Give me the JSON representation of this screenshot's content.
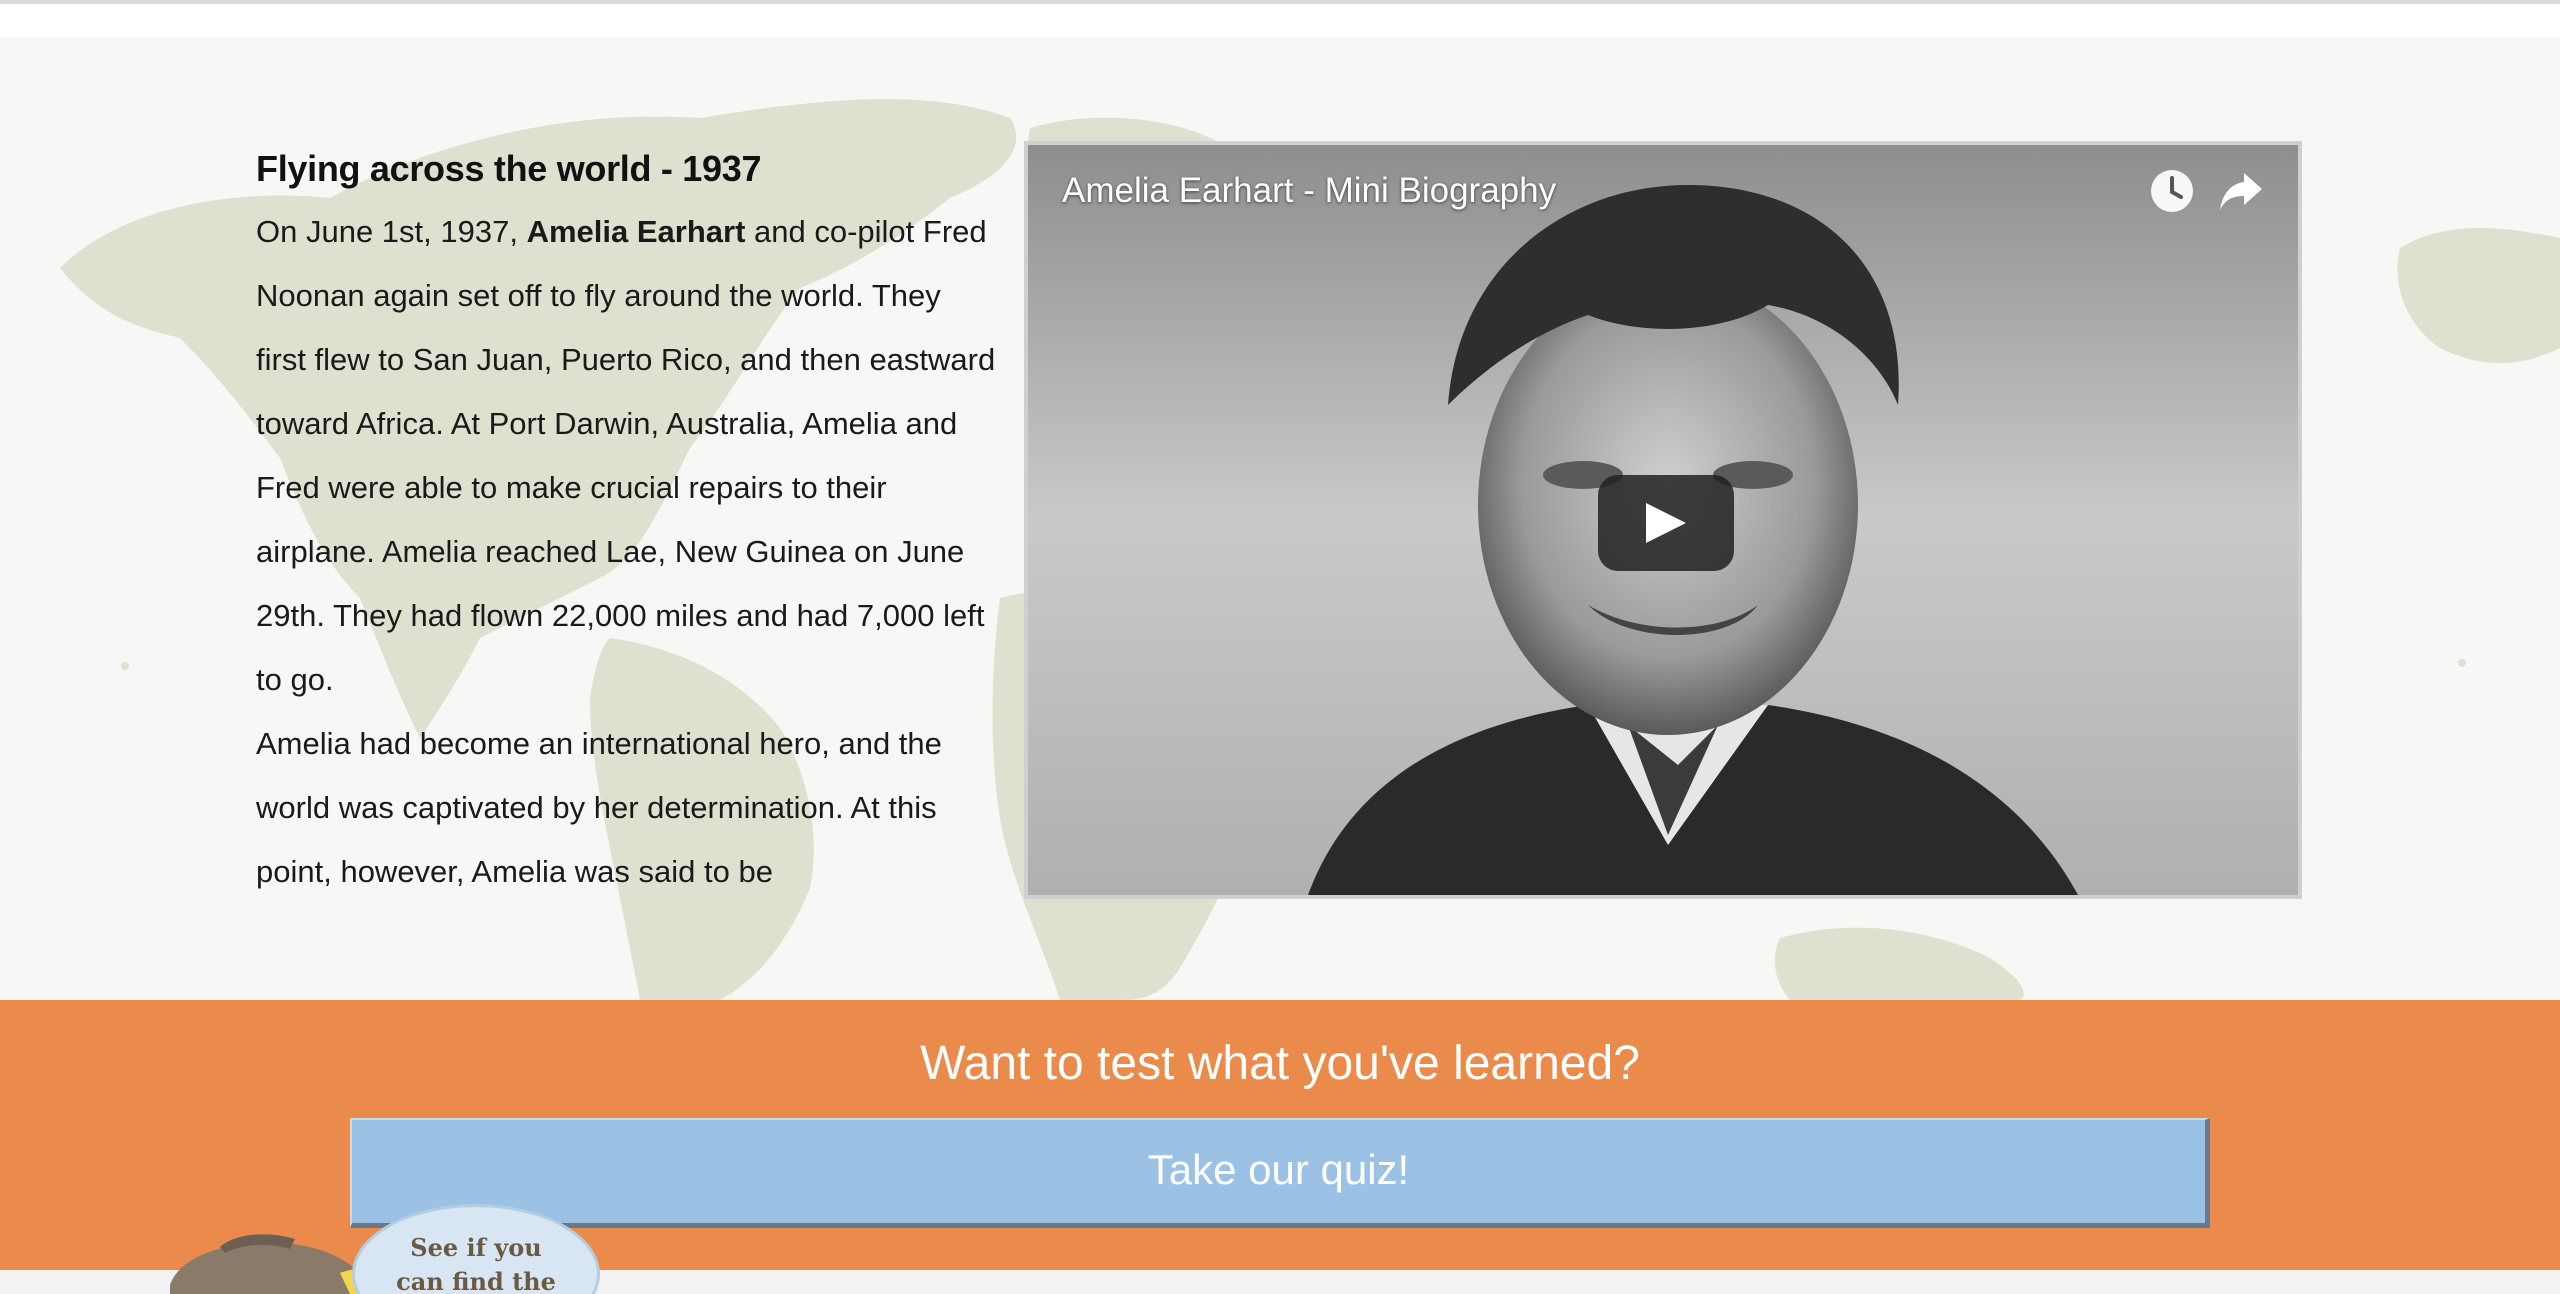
{
  "article": {
    "title": "Flying across the world - 1937",
    "para1_lead": "On June 1st, 1937, ",
    "para1_name": "Amelia Earhart",
    "para1_rest": " and co-pilot Fred Noonan again set off to fly around the world. They first flew to San Juan, Puerto Rico, and then eastward toward Africa. At Port Darwin, Australia, Amelia and Fred were able to make crucial repairs to their airplane. Amelia reached Lae, New Guinea on June 29th. They had flown 22,000 miles and had 7,000 left to go.",
    "para2": "Amelia had become an international hero, and the world was captivated by her determination. At this point, however, Amelia was said to be"
  },
  "video": {
    "title": "Amelia Earhart - Mini Biography",
    "watch_later_icon": "clock-icon",
    "share_icon": "share-arrow-icon",
    "play_icon": "play-icon"
  },
  "quiz": {
    "heading": "Want to test what you've learned?",
    "button_label": "Take our quiz!"
  },
  "hint": {
    "line1": "See if you",
    "line2": "can find the"
  },
  "colors": {
    "page_background": "#f7f8f5",
    "map_land": "#dce2cf",
    "quiz_background": "#eb8b4b",
    "quiz_button": "#9bc1e5"
  }
}
